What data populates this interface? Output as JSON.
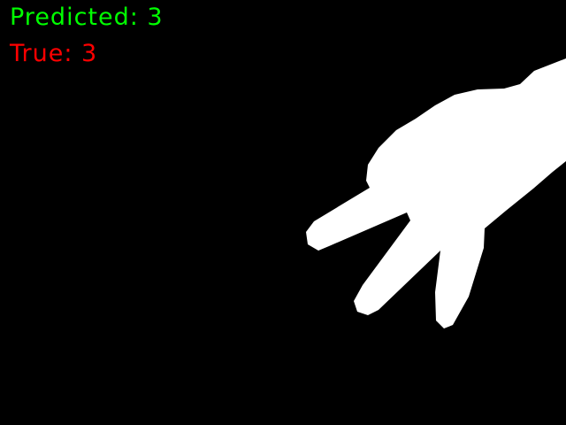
{
  "overlay": {
    "predicted_text": "Predicted: 3",
    "true_text": "True: 3",
    "predicted_color": "#00FF00",
    "true_color": "#FF0000"
  },
  "image": {
    "background_color": "#000000",
    "mask_color": "#FFFFFF"
  }
}
